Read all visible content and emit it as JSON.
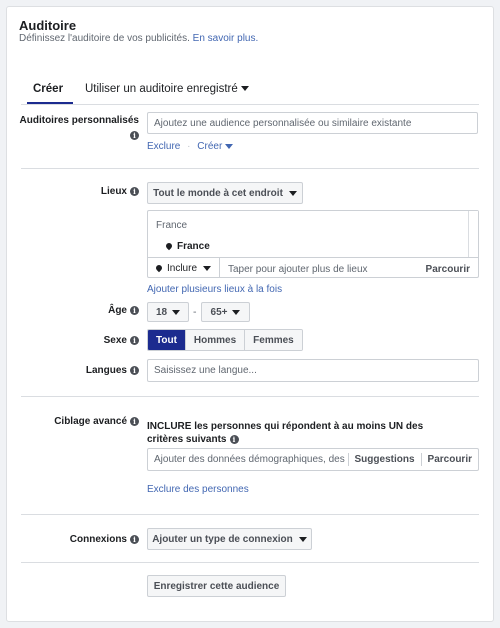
{
  "header": {
    "title": "Auditoire",
    "subtitle": "Définissez l'auditoire de vos publicités.",
    "learn_more": "En savoir plus."
  },
  "tabs": {
    "create": "Créer",
    "saved": "Utiliser un auditoire enregistré"
  },
  "custom_audiences": {
    "label": "Auditoires personnalisés",
    "placeholder": "Ajoutez une audience personnalisée ou similaire existante",
    "exclude": "Exclure",
    "create": "Créer"
  },
  "locations": {
    "label": "Lieux",
    "dropdown": "Tout le monde à cet endroit",
    "country_header": "France",
    "selected": "France",
    "include": "Inclure",
    "placeholder": "Taper pour ajouter plus de lieux",
    "browse": "Parcourir",
    "bulk_add": "Ajouter plusieurs lieux à la fois"
  },
  "age": {
    "label": "Âge",
    "min": "18",
    "dash": "-",
    "max": "65+"
  },
  "gender": {
    "label": "Sexe",
    "options": [
      "Tout",
      "Hommes",
      "Femmes"
    ]
  },
  "languages": {
    "label": "Langues",
    "placeholder": "Saisissez une langue..."
  },
  "detailed_targeting": {
    "label": "Ciblage avancé",
    "include_text": "INCLURE les personnes qui répondent à au moins UN des critères suivants",
    "placeholder": "Ajouter des données démographiques, des i...",
    "suggestions": "Suggestions",
    "browse": "Parcourir",
    "exclude": "Exclure des personnes"
  },
  "connections": {
    "label": "Connexions",
    "button": "Ajouter un type de connexion"
  },
  "save_button": "Enregistrer cette audience"
}
